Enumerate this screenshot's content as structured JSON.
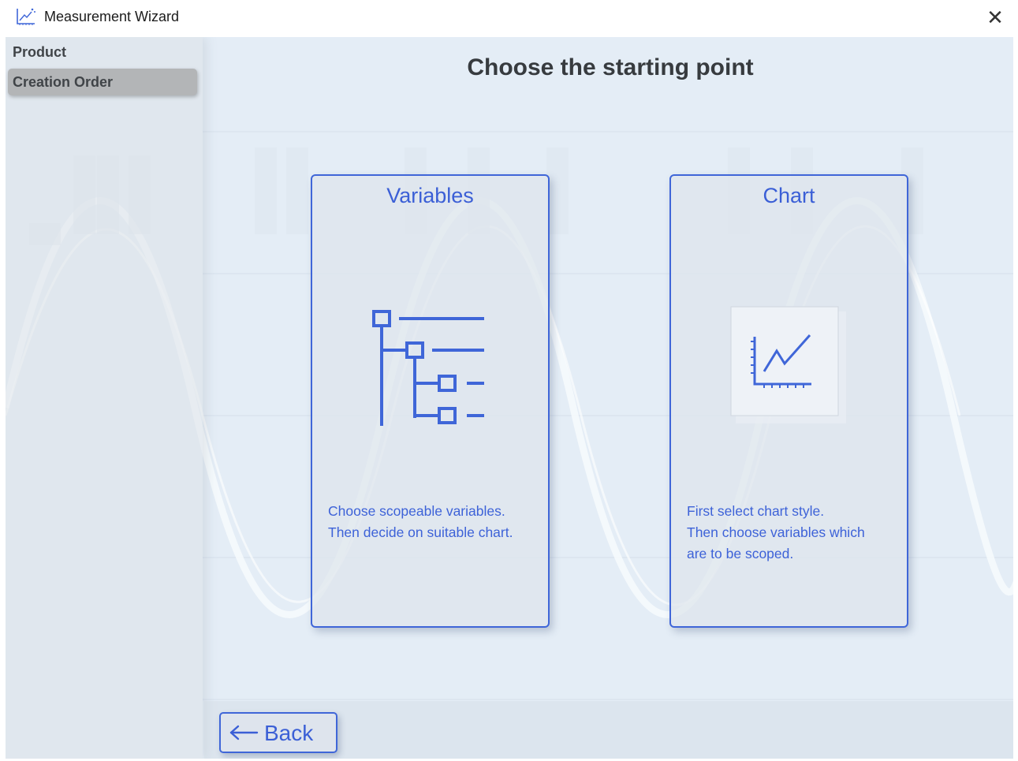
{
  "window": {
    "title": "Measurement Wizard",
    "app_icon": "chart-wand-icon",
    "close_icon": "close-icon",
    "close_glyph": "✕"
  },
  "sidebar": {
    "items": [
      {
        "label": "Product",
        "active": false
      },
      {
        "label": "Creation Order",
        "active": true
      }
    ]
  },
  "main": {
    "title": "Choose the starting point",
    "cards": [
      {
        "title": "Variables",
        "icon": "variable-tree-icon",
        "description": [
          "Choose scopeable variables.",
          "Then decide on suitable chart."
        ]
      },
      {
        "title": "Chart",
        "icon": "line-chart-icon",
        "description": [
          "First select chart style.",
          "Then choose variables which",
          "are to be scoped."
        ]
      }
    ]
  },
  "footer": {
    "back_label": "Back",
    "back_icon": "arrow-left-icon"
  },
  "colors": {
    "accent": "#3f66d8",
    "background": "#e4edf6",
    "sidebar_active": "#b3b5b7"
  }
}
